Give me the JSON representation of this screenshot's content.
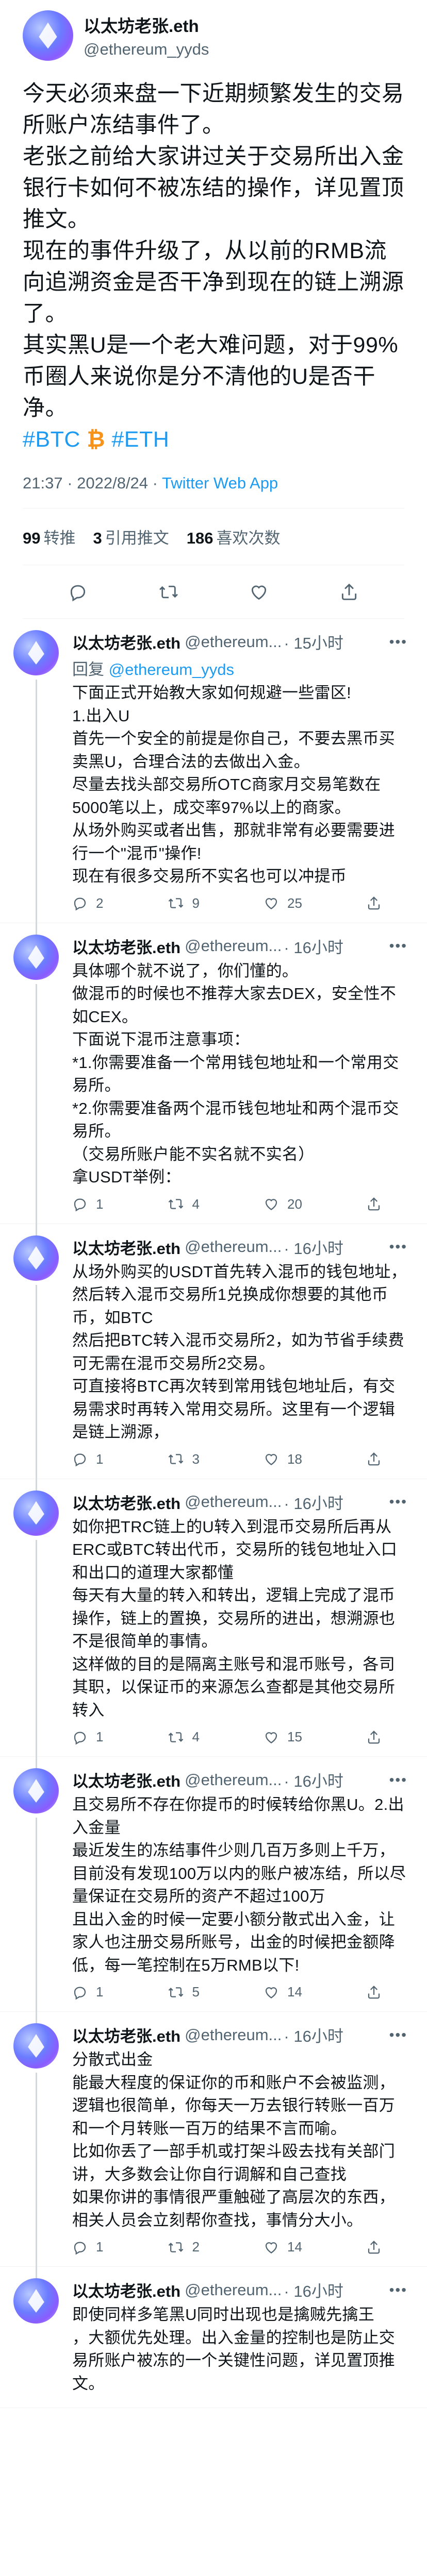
{
  "main_tweet": {
    "author": {
      "name": "以太坊老张.eth",
      "handle": "@ethereum_yyds"
    },
    "text_lines": [
      "今天必须来盘一下近期频繁发生的交易所账户冻结事件了。",
      "老张之前给大家讲过关于交易所出入金银行卡如何不被冻结的操作，详见置顶推文。",
      "现在的事件升级了，从以前的RMB流向追溯资金是否干净到现在的链上溯源了。",
      "其实黑U是一个老大难问题，对于99%币圈人来说你是分不清他的U是否干净。"
    ],
    "hashtag_btc": "#BTC",
    "btc_emoji": "₿",
    "hashtag_eth": "#ETH",
    "time": "21:37 · 2022/8/24 · ",
    "source": "Twitter Web App",
    "stats": {
      "retweets_count": "99",
      "retweets_label": "转推",
      "quotes_count": "3",
      "quotes_label": "引用推文",
      "likes_count": "186",
      "likes_label": "喜欢次数"
    }
  },
  "replies": [
    {
      "name": "以太坊老张.eth",
      "handle": "@ethereum...",
      "time": "· 15小时",
      "reply_to_prefix": "回复 ",
      "reply_to_handle": "@ethereum_yyds",
      "lines": [
        "下面正式开始教大家如何规避一些雷区!",
        "1.出入U",
        "首先一个安全的前提是你自己，不要去黑币买卖黑U，合理合法的去做出入金。",
        "尽量去找头部交易所OTC商家月交易笔数在5000笔以上，成交率97%以上的商家。",
        "从场外购买或者出售，那就非常有必要需要进行一个\"混币\"操作!",
        "现在有很多交易所不实名也可以冲提币"
      ],
      "reply_count": "2",
      "retweet_count": "9",
      "like_count": "25"
    },
    {
      "name": "以太坊老张.eth",
      "handle": "@ethereum...",
      "time": "· 16小时",
      "reply_to_prefix": "",
      "reply_to_handle": "",
      "lines": [
        "具体哪个就不说了，你们懂的。",
        "做混币的时候也不推荐大家去DEX，安全性不如CEX。",
        "下面说下混币注意事项：",
        "*1.你需要准备一个常用钱包地址和一个常用交易所。",
        "*2.你需要准备两个混币钱包地址和两个混币交易所。",
        "（交易所账户能不实名就不实名）",
        "拿USDT举例："
      ],
      "reply_count": "1",
      "retweet_count": "4",
      "like_count": "20"
    },
    {
      "name": "以太坊老张.eth",
      "handle": "@ethereum...",
      "time": "· 16小时",
      "reply_to_prefix": "",
      "reply_to_handle": "",
      "lines": [
        "从场外购买的USDT首先转入混币的钱包地址，然后转入混币交易所1兑换成你想要的其他币币，如BTC",
        "然后把BTC转入混币交易所2，如为节省手续费可无需在混币交易所2交易。",
        "可直接将BTC再次转到常用钱包地址后，有交易需求时再转入常用交易所。这里有一个逻辑是链上溯源，"
      ],
      "reply_count": "1",
      "retweet_count": "3",
      "like_count": "18"
    },
    {
      "name": "以太坊老张.eth",
      "handle": "@ethereum...",
      "time": "· 16小时",
      "reply_to_prefix": "",
      "reply_to_handle": "",
      "lines": [
        "如你把TRC链上的U转入到混币交易所后再从ERC或BTC转出代币，交易所的钱包地址入口和出口的道理大家都懂",
        "每天有大量的转入和转出，逻辑上完成了混币操作，链上的置换，交易所的进出，想溯源也不是很简单的事情。",
        "这样做的目的是隔离主账号和混币账号，各司其职，以保证币的来源怎么查都是其他交易所转入"
      ],
      "reply_count": "1",
      "retweet_count": "4",
      "like_count": "15"
    },
    {
      "name": "以太坊老张.eth",
      "handle": "@ethereum...",
      "time": "· 16小时",
      "reply_to_prefix": "",
      "reply_to_handle": "",
      "lines": [
        "且交易所不存在你提币的时候转给你黑U。2.出入金量",
        "最近发生的冻结事件少则几百万多则上千万，目前没有发现100万以内的账户被冻结，所以尽量保证在交易所的资产不超过100万",
        "且出入金的时候一定要小额分散式出入金，让家人也注册交易所账号，出金的时候把金额降低，每一笔控制在5万RMB以下!"
      ],
      "reply_count": "1",
      "retweet_count": "5",
      "like_count": "14"
    },
    {
      "name": "以太坊老张.eth",
      "handle": "@ethereum...",
      "time": "· 16小时",
      "reply_to_prefix": "",
      "reply_to_handle": "",
      "lines": [
        "分散式出金",
        "能最大程度的保证你的币和账户不会被监测，逻辑也很简单，你每天一万去银行转账一百万和一个月转账一百万的结果不言而喻。",
        "比如你丢了一部手机或打架斗殴去找有关部门讲，大多数会让你自行调解和自己查找",
        "如果你讲的事情很严重触碰了高层次的东西，相关人员会立刻帮你查找，事情分大小。"
      ],
      "reply_count": "1",
      "retweet_count": "2",
      "like_count": "14"
    },
    {
      "name": "以太坊老张.eth",
      "handle": "@ethereum...",
      "time": "· 16小时",
      "reply_to_prefix": "",
      "reply_to_handle": "",
      "lines": [
        "即使同样多笔黑U同时出现也是擒贼先擒王",
        "，大额优先处理。出入金量的控制也是防止交易所账户被冻的一个关键性问题，详见置顶推文。"
      ],
      "reply_count": "",
      "retweet_count": "",
      "like_count": ""
    }
  ],
  "icons": {
    "reply": "reply-icon",
    "retweet": "retweet-icon",
    "like": "heart-icon",
    "share": "share-icon",
    "more": "more-icon"
  }
}
